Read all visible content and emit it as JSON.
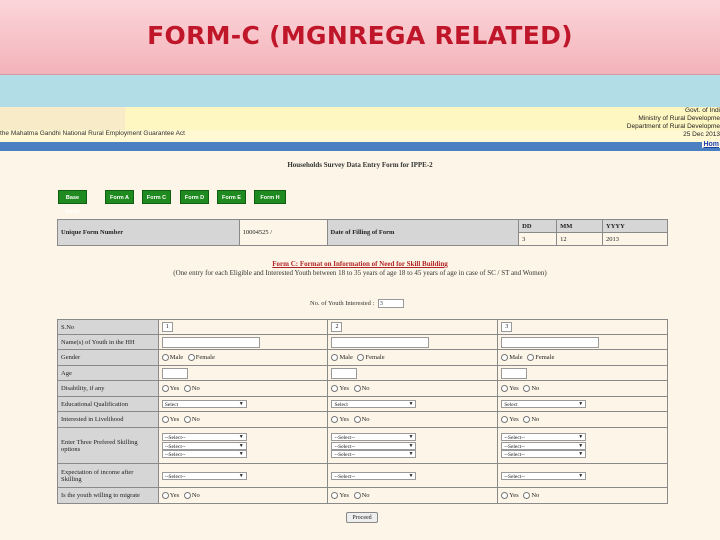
{
  "slide_title": "FORM-C (MGNREGA RELATED)",
  "header": {
    "act_text": "the Mahatma Gandhi National Rural Employment Guarantee Act",
    "gov_lines": [
      "Govt. of Indi",
      "Ministry of Rural Developme",
      "Department of Rural Developme",
      "25 Dec 2013"
    ],
    "home_link": "Hom"
  },
  "survey_title": "Households Survey Data Entry Form for IPPE-2",
  "nav_buttons": [
    "Base Form",
    "Form A",
    "Form C",
    "Form D",
    "Form E",
    "Form H"
  ],
  "top_table": {
    "unique_form_label": "Unique Form Number",
    "unique_form_value": "10004525 /",
    "date_label": "Date of Filling of Form",
    "dd_label": "DD",
    "mm_label": "MM",
    "yyyy_label": "YYYY",
    "dd_value": "3",
    "mm_value": "12",
    "yyyy_value": "2013"
  },
  "form_c": {
    "title": "Form C: Format on Information of Need for Skill Building",
    "subtitle": "(One entry for each Eligible and Interested Youth between 18 to 35 years of age 18 to 45 years of age in case of SC / ST and Women)",
    "youth_count_label": "No. of Youth Interested :",
    "youth_count_value": "3"
  },
  "rows": {
    "sno": "S.No",
    "name": "Name(s) of Youth in the HH",
    "gender": "Gender",
    "age": "Age",
    "disability": "Disability, if any",
    "education": "Educational Qualification",
    "livelihood": "Interested in Livelihood",
    "skilling": "Enter Three Prefered Skilling options",
    "income": "Expectation of income after Skilling",
    "migrate": "Is the youth willing to migrate"
  },
  "columns": [
    {
      "sno": "1",
      "select_edu": "Select",
      "skill1": "--Select--",
      "skill2": "--Select--",
      "skill3": "--Select--",
      "income": "--Select--"
    },
    {
      "sno": "2",
      "select_edu": "Select",
      "skill1": "--Select--",
      "skill2": "--Select--",
      "skill3": "--Select--",
      "income": "--Select--"
    },
    {
      "sno": "3",
      "select_edu": "Select",
      "skill1": "--Select--",
      "skill2": "--Select--",
      "skill3": "--Select--",
      "income": "--Select--"
    }
  ],
  "options": {
    "male": "Male",
    "female": "Female",
    "yes": "Yes",
    "no": "No"
  },
  "proceed_label": "Proceed",
  "colors": {
    "title_red": "#c0162a",
    "nav_green": "#1f8a1f",
    "link_blue": "#1a3fa8"
  }
}
